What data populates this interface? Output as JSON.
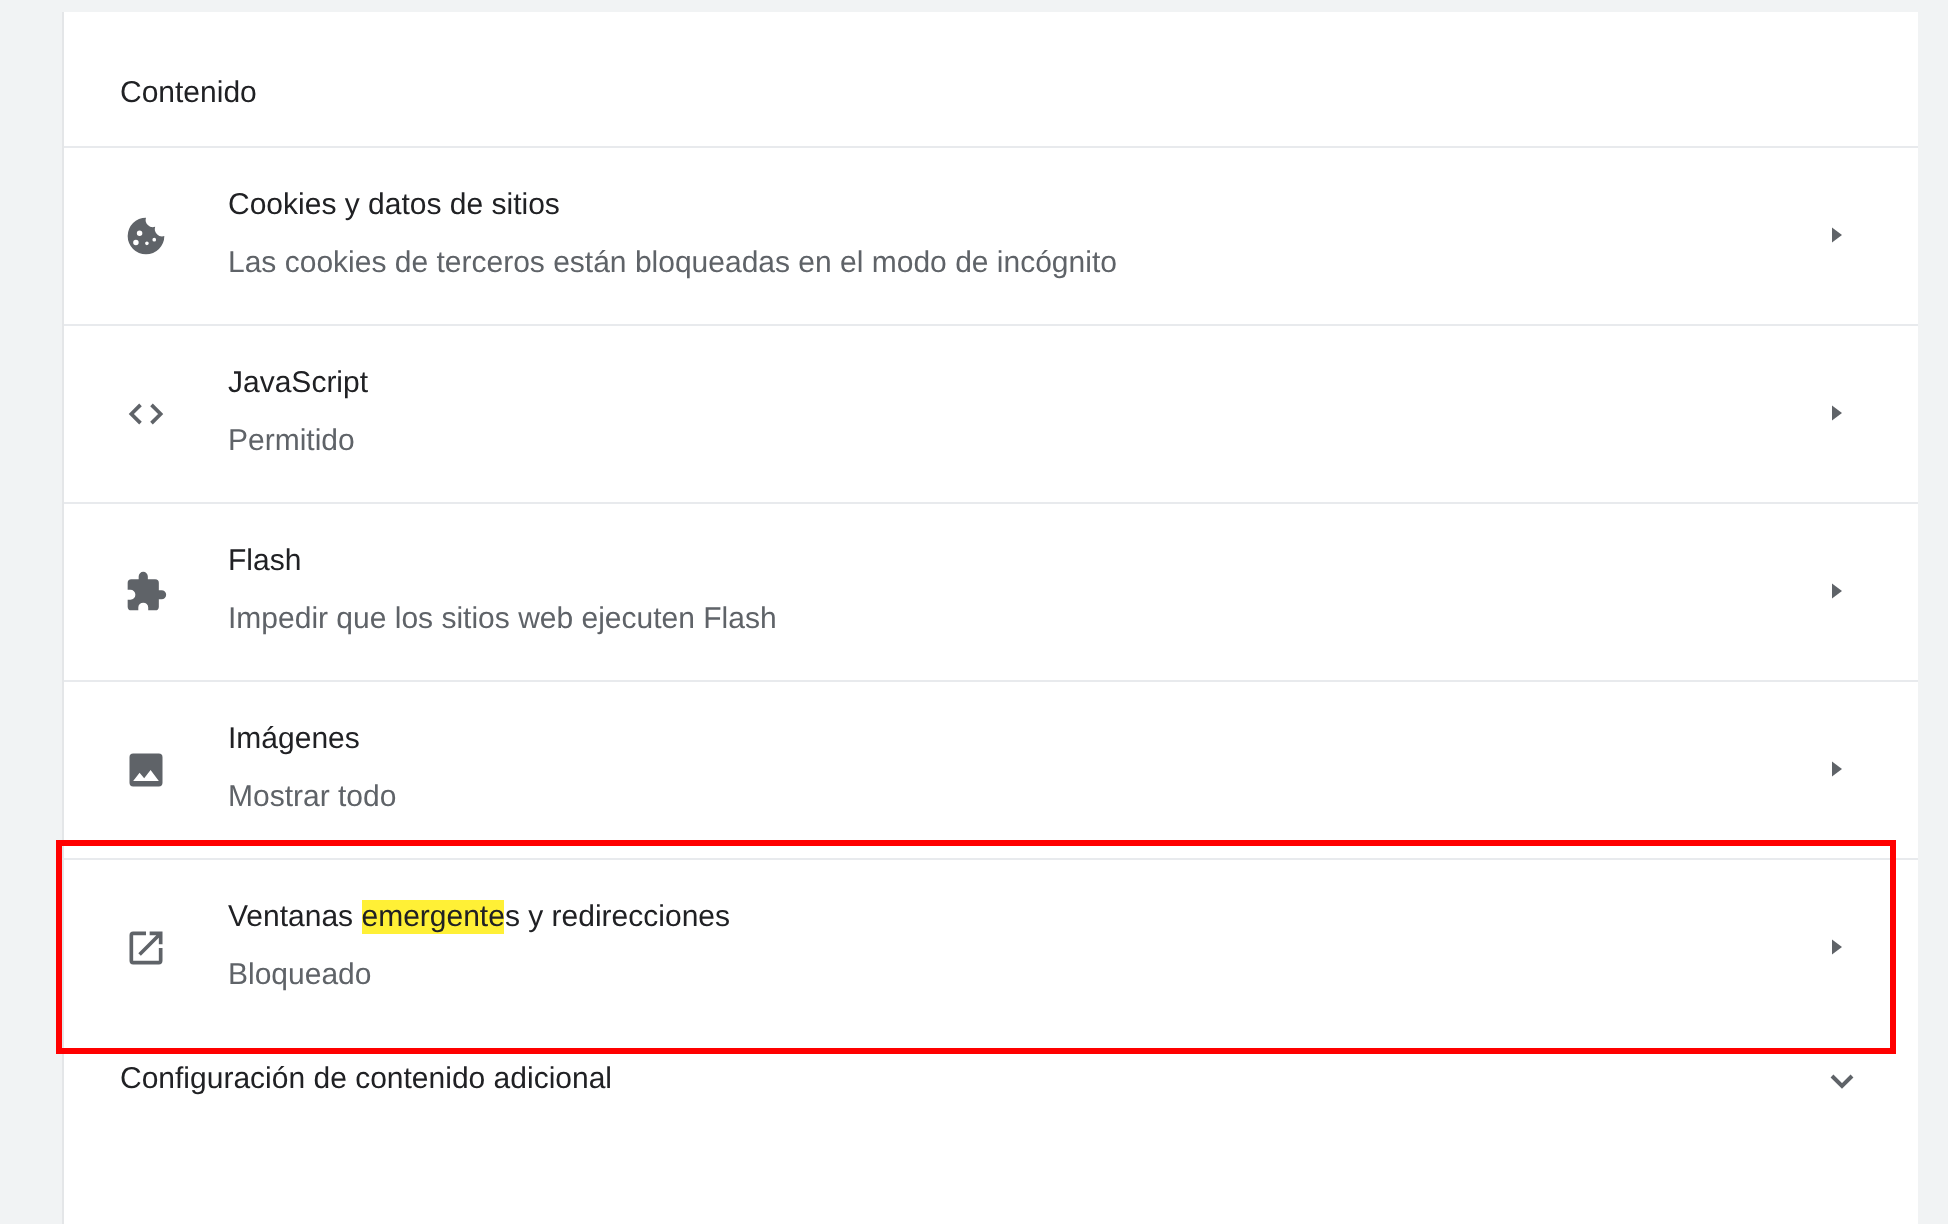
{
  "section": {
    "heading": "Contenido"
  },
  "items": [
    {
      "kind": "cookie",
      "title": [
        {
          "text": "Cookies y datos de sitios",
          "highlighted": false
        }
      ],
      "subtitle": "Las cookies de terceros están bloqueadas en el modo de incógnito",
      "framed": false
    },
    {
      "kind": "code",
      "title": [
        {
          "text": "JavaScript",
          "highlighted": false
        }
      ],
      "subtitle": "Permitido",
      "framed": false
    },
    {
      "kind": "puzzle",
      "title": [
        {
          "text": "Flash",
          "highlighted": false
        }
      ],
      "subtitle": "Impedir que los sitios web ejecuten Flash",
      "framed": false
    },
    {
      "kind": "image",
      "title": [
        {
          "text": "Imágenes",
          "highlighted": false
        }
      ],
      "subtitle": "Mostrar todo",
      "framed": false
    },
    {
      "kind": "popup",
      "title": [
        {
          "text": "Ventanas ",
          "highlighted": false
        },
        {
          "text": "emergente",
          "highlighted": true
        },
        {
          "text": "s y redirecciones",
          "highlighted": false
        }
      ],
      "subtitle": "Bloqueado",
      "framed": true
    }
  ],
  "additional": {
    "label": "Configuración de contenido adicional",
    "expanded": false
  }
}
